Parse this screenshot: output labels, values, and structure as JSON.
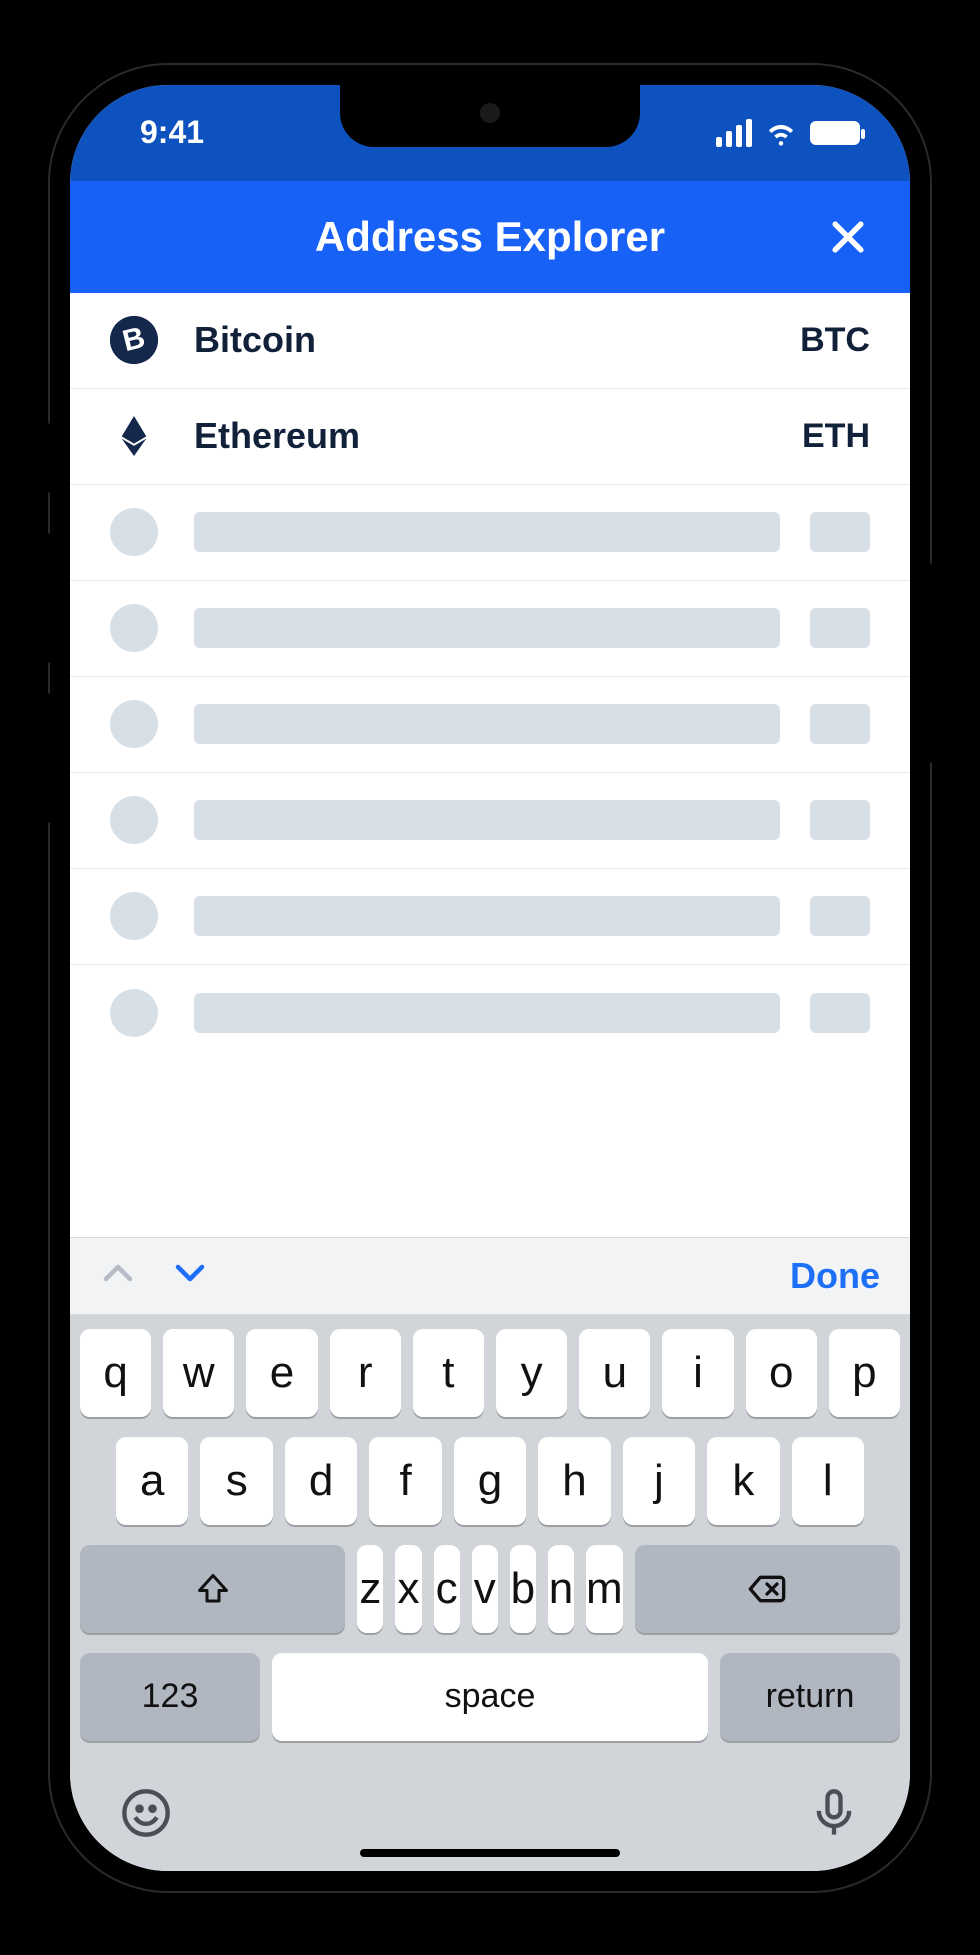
{
  "status": {
    "time": "9:41"
  },
  "nav": {
    "title": "Address Explorer"
  },
  "assets": [
    {
      "name": "Bitcoin",
      "symbol": "BTC"
    },
    {
      "name": "Ethereum",
      "symbol": "ETH"
    }
  ],
  "accessory": {
    "done_label": "Done"
  },
  "keyboard": {
    "row1": [
      "q",
      "w",
      "e",
      "r",
      "t",
      "y",
      "u",
      "i",
      "o",
      "p"
    ],
    "row2": [
      "a",
      "s",
      "d",
      "f",
      "g",
      "h",
      "j",
      "k",
      "l"
    ],
    "row3": [
      "z",
      "x",
      "c",
      "v",
      "b",
      "n",
      "m"
    ],
    "num_label": "123",
    "space_label": "space",
    "return_label": "return"
  }
}
